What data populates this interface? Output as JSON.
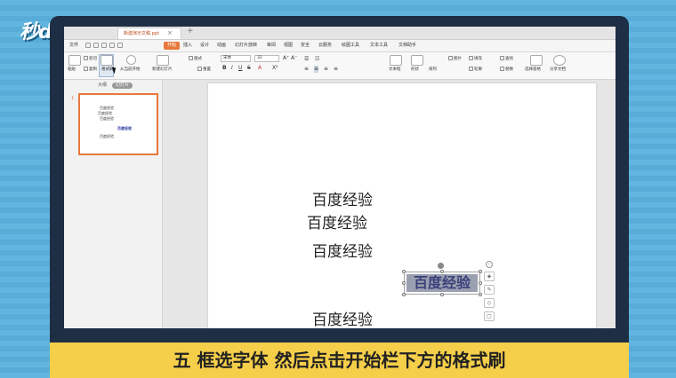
{
  "branding": {
    "logo_text": "秒dong视频"
  },
  "window": {
    "file_tab": "新建演示文稿.ppt",
    "new_tab": "+"
  },
  "menu": {
    "quick_label": "文件",
    "items": [
      {
        "label": "开始",
        "active": true
      },
      {
        "label": "插入"
      },
      {
        "label": "设计"
      },
      {
        "label": "动画"
      },
      {
        "label": "幻灯片放映"
      },
      {
        "label": "审阅"
      },
      {
        "label": "视图"
      },
      {
        "label": "安全"
      },
      {
        "label": "云服务"
      },
      {
        "label": "绘图工具"
      },
      {
        "label": "文本工具"
      },
      {
        "label": "文档助手"
      }
    ]
  },
  "ribbon": {
    "paste": "粘贴",
    "cut": "剪切",
    "copy": "复制",
    "format_painter": "格式刷",
    "play_from": "从当前开始",
    "new_slide": "新建幻灯片",
    "layout": "版式",
    "reset": "重置",
    "font_name": "宋体",
    "font_size": "32",
    "textbox": "文本框",
    "shape": "形状",
    "arrange": "排列",
    "picture": "图片",
    "fill": "填充",
    "outline": "轮廓",
    "find": "查找",
    "replace": "替换",
    "select_pane": "选择窗格",
    "share": "分享文档"
  },
  "left_panel": {
    "tab_outline": "大纲",
    "tab_slides": "幻灯片",
    "slide_number": "1",
    "thumb_lines": [
      "百度经验",
      "百度经验",
      "百度经验",
      "百度经验",
      "百度经验"
    ]
  },
  "slide": {
    "lines": [
      "百度经验",
      "百度经验",
      "百度经验",
      "百度经验"
    ],
    "selected_text": "百度经验"
  },
  "subtitle": "五 框选字体 然后点击开始栏下方的格式刷",
  "colors": {
    "accent": "#e8783c",
    "subtitle_bg": "#f6cf4a",
    "frame": "#1e2e44"
  }
}
